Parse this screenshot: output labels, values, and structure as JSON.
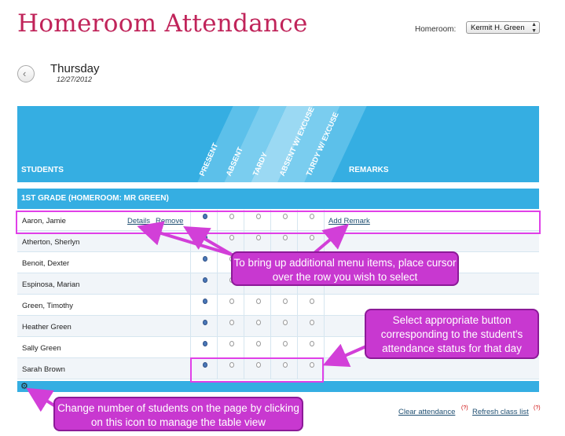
{
  "page_title": "Homeroom Attendance",
  "homeroom_label": "Homeroom:",
  "homeroom_value": "Kermit H. Green",
  "day": "Thursday",
  "date": "12/27/2012",
  "columns": {
    "students": "STUDENTS",
    "present": "PRESENT",
    "absent": "ABSENT",
    "tardy": "TARDY",
    "absent_excused": "ABSENT W/ EXCUSE",
    "tardy_excused": "TARDY W/ EXCUSE",
    "remarks": "REMARKS"
  },
  "group_title": "1ST GRADE (HOMEROOM: MR GREEN)",
  "students": [
    {
      "name": "Aaron, Jamie",
      "status": "present"
    },
    {
      "name": "Atherton, Sherlyn",
      "status": "present"
    },
    {
      "name": "Benoit, Dexter",
      "status": "present"
    },
    {
      "name": "Espinosa, Marian",
      "status": "present"
    },
    {
      "name": "Green, Timothy",
      "status": "present"
    },
    {
      "name": "Heather Green",
      "status": "present"
    },
    {
      "name": "Sally Green",
      "status": "present"
    },
    {
      "name": "Sarah Brown",
      "status": "present"
    }
  ],
  "row_actions": {
    "details": "Details",
    "remove": "Remove",
    "add_remark": "Add Remark"
  },
  "footer": {
    "clear": "Clear attendance",
    "refresh": "Refresh class list",
    "help_mark": "(?)"
  },
  "callouts": {
    "row": "To bring up additional menu items, place cursor over the row you wish to select",
    "status": "Select appropriate button corresponding to the student's attendance status for that day",
    "gear": "Change number of students on the page by clicking on this icon to manage the table view"
  },
  "colors": {
    "brand": "#c0245a",
    "header_blue": "#35aee2",
    "annotation": "#c838d0"
  }
}
